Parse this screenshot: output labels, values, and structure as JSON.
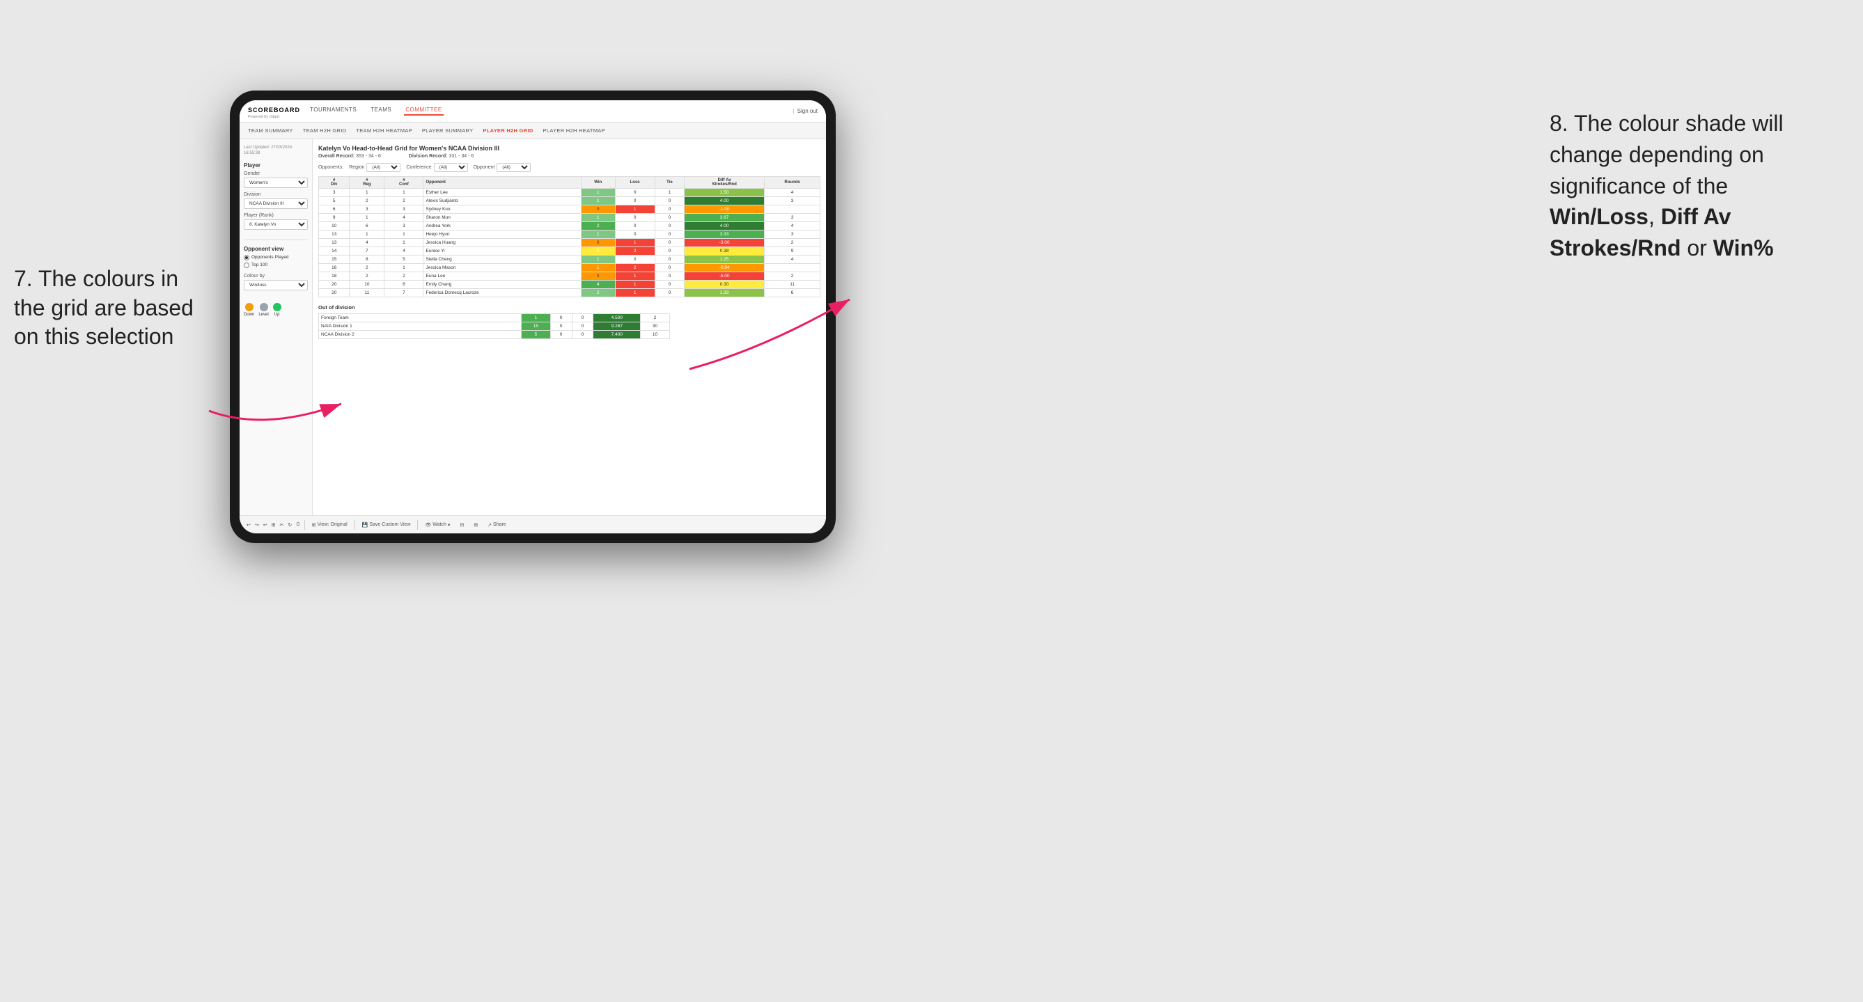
{
  "annotations": {
    "left_title": "7. The colours in the grid are based on this selection",
    "right_title": "8. The colour shade will change depending on significance of the",
    "right_bold1": "Win/Loss",
    "right_bold2": "Diff Av Strokes/Rnd",
    "right_bold3": "Win%",
    "right_or": " or "
  },
  "nav": {
    "logo": "SCOREBOARD",
    "logo_sub": "Powered by clippd",
    "items": [
      "TOURNAMENTS",
      "TEAMS",
      "COMMITTEE"
    ],
    "active": "COMMITTEE",
    "sign_out": "Sign out"
  },
  "sub_nav": {
    "items": [
      "TEAM SUMMARY",
      "TEAM H2H GRID",
      "TEAM H2H HEATMAP",
      "PLAYER SUMMARY",
      "PLAYER H2H GRID",
      "PLAYER H2H HEATMAP"
    ],
    "active": "PLAYER H2H GRID"
  },
  "sidebar": {
    "last_updated_label": "Last Updated: 27/03/2024",
    "last_updated_time": "16:55:38",
    "player_section": "Player",
    "gender_label": "Gender",
    "gender_value": "Women's",
    "division_label": "Division",
    "division_value": "NCAA Division III",
    "player_rank_label": "Player (Rank)",
    "player_rank_value": "8. Katelyn Vo",
    "opponent_view_title": "Opponent view",
    "opponent_played": "Opponents Played",
    "top_100": "Top 100",
    "colour_by_label": "Colour by",
    "colour_by_value": "Win/loss",
    "legend_down": "Down",
    "legend_level": "Level",
    "legend_up": "Up"
  },
  "grid": {
    "title": "Katelyn Vo Head-to-Head Grid for Women's NCAA Division III",
    "overall_record_label": "Overall Record:",
    "overall_record_value": "353 - 34 - 6",
    "division_record_label": "Division Record:",
    "division_record_value": "331 - 34 - 6",
    "opponents_label": "Opponents:",
    "region_label": "Region",
    "region_value": "(All)",
    "conference_label": "Conference",
    "conference_value": "(All)",
    "opponent_label": "Opponent",
    "opponent_value": "(All)",
    "columns": [
      "#\nDiv",
      "#\nReg",
      "#\nConf",
      "Opponent",
      "Win",
      "Loss",
      "Tie",
      "Diff Av\nStrokes/Rnd",
      "Rounds"
    ],
    "rows": [
      {
        "div": 3,
        "reg": 1,
        "conf": 1,
        "opponent": "Esther Lee",
        "win": 1,
        "loss": 0,
        "tie": 1,
        "diff": 1.5,
        "rounds": 4,
        "win_color": "green",
        "diff_color": "green-light"
      },
      {
        "div": 5,
        "reg": 2,
        "conf": 2,
        "opponent": "Alexis Sudjianto",
        "win": 1,
        "loss": 0,
        "tie": 0,
        "diff": 4.0,
        "rounds": 3,
        "win_color": "green",
        "diff_color": "green-dark"
      },
      {
        "div": 6,
        "reg": 3,
        "conf": 3,
        "opponent": "Sydney Kuo",
        "win": 0,
        "loss": 1,
        "tie": 0,
        "diff": -1.0,
        "rounds": "",
        "win_color": "white",
        "diff_color": "yellow"
      },
      {
        "div": 9,
        "reg": 1,
        "conf": 4,
        "opponent": "Sharon Mun",
        "win": 1,
        "loss": 0,
        "tie": 0,
        "diff": 3.67,
        "rounds": 3,
        "win_color": "green",
        "diff_color": "green-med"
      },
      {
        "div": 10,
        "reg": 6,
        "conf": 3,
        "opponent": "Andrea York",
        "win": 2,
        "loss": 0,
        "tie": 0,
        "diff": 4.0,
        "rounds": 4,
        "win_color": "green-dark",
        "diff_color": "green-dark"
      },
      {
        "div": 13,
        "reg": 1,
        "conf": 1,
        "opponent": "Heejo Hyun",
        "win": 1,
        "loss": 0,
        "tie": 0,
        "diff": 3.33,
        "rounds": 3,
        "win_color": "green",
        "diff_color": "green-med"
      },
      {
        "div": 13,
        "reg": 4,
        "conf": 1,
        "opponent": "Jessica Huang",
        "win": 0,
        "loss": 1,
        "tie": 0,
        "diff": -3.0,
        "rounds": 2,
        "win_color": "white",
        "diff_color": "orange"
      },
      {
        "div": 14,
        "reg": 7,
        "conf": 4,
        "opponent": "Eunice Yi",
        "win": 2,
        "loss": 2,
        "tie": 0,
        "diff": 0.38,
        "rounds": 9,
        "win_color": "yellow",
        "diff_color": "yellow-light"
      },
      {
        "div": 15,
        "reg": 8,
        "conf": 5,
        "opponent": "Stella Cheng",
        "win": 1,
        "loss": 0,
        "tie": 0,
        "diff": 1.25,
        "rounds": 4,
        "win_color": "green",
        "diff_color": "green-light"
      },
      {
        "div": 16,
        "reg": 2,
        "conf": 1,
        "opponent": "Jessica Mason",
        "win": 1,
        "loss": 2,
        "tie": 0,
        "diff": -0.94,
        "rounds": "",
        "win_color": "red-light",
        "diff_color": "yellow"
      },
      {
        "div": 18,
        "reg": 2,
        "conf": 2,
        "opponent": "Euna Lee",
        "win": 0,
        "loss": 1,
        "tie": 0,
        "diff": -5.0,
        "rounds": 2,
        "win_color": "white",
        "diff_color": "red"
      },
      {
        "div": 20,
        "reg": 10,
        "conf": 6,
        "opponent": "Emily Chang",
        "win": 4,
        "loss": 1,
        "tie": 0,
        "diff": 0.3,
        "rounds": 11,
        "win_color": "green-dark",
        "diff_color": "yellow-light"
      },
      {
        "div": 20,
        "reg": 11,
        "conf": 7,
        "opponent": "Federica Domecq Lacroze",
        "win": 2,
        "loss": 1,
        "tie": 0,
        "diff": 1.33,
        "rounds": 6,
        "win_color": "green",
        "diff_color": "green-light"
      }
    ],
    "out_of_division_title": "Out of division",
    "out_of_division_rows": [
      {
        "name": "Foreign Team",
        "win": 1,
        "loss": 0,
        "tie": 0,
        "diff": 4.5,
        "rounds": 2,
        "diff_color": "green-dark"
      },
      {
        "name": "NAIA Division 1",
        "win": 15,
        "loss": 0,
        "tie": 0,
        "diff": 9.267,
        "rounds": 30,
        "diff_color": "green-dark"
      },
      {
        "name": "NCAA Division 2",
        "win": 5,
        "loss": 0,
        "tie": 0,
        "diff": 7.4,
        "rounds": 10,
        "diff_color": "green-dark"
      }
    ]
  },
  "toolbar": {
    "view_original": "View: Original",
    "save_custom": "Save Custom View",
    "watch": "Watch",
    "share": "Share"
  }
}
